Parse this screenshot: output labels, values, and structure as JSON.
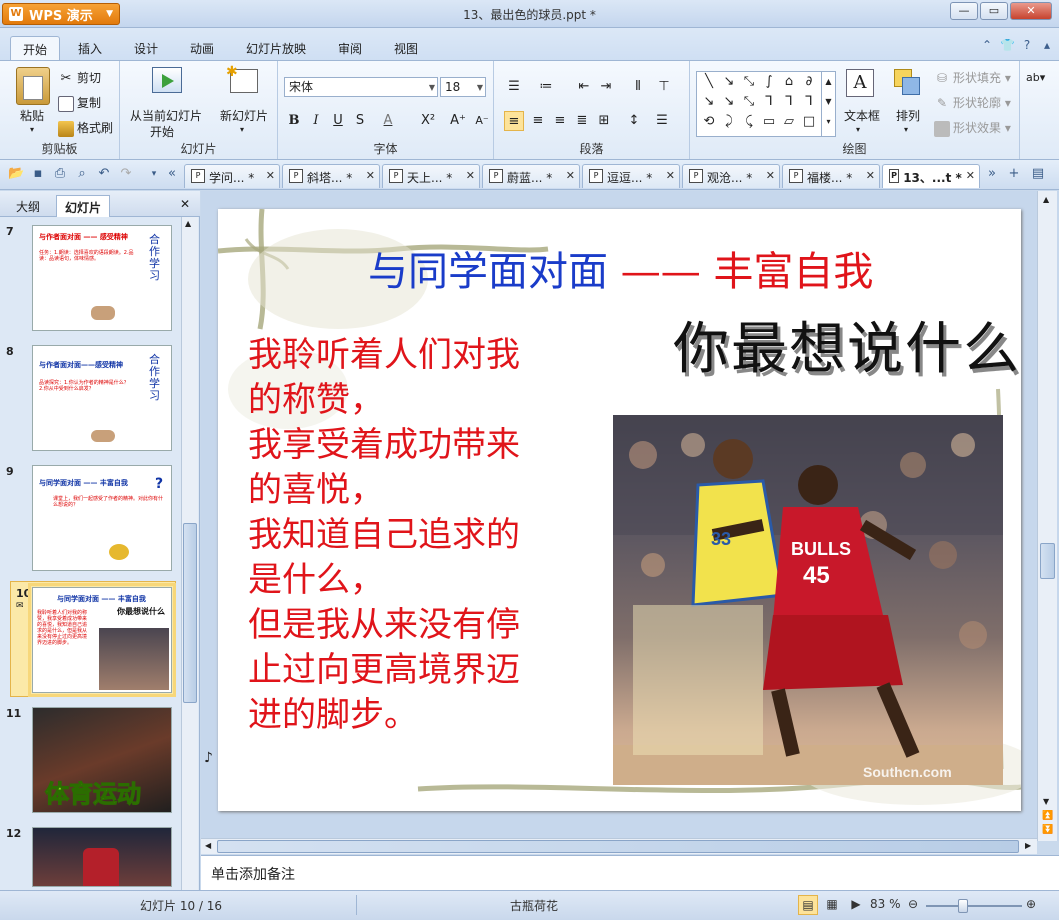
{
  "window": {
    "app_button": "WPS 演示",
    "title": "13、最出色的球员.ppt *"
  },
  "menu_tabs": [
    "开始",
    "插入",
    "设计",
    "动画",
    "幻灯片放映",
    "审阅",
    "视图"
  ],
  "ribbon": {
    "clipboard": {
      "paste": "粘贴",
      "cut": "剪切",
      "copy": "复制",
      "format_painter": "格式刷",
      "label": "剪贴板"
    },
    "slides": {
      "from_current": "从当前幻灯片",
      "from_current2": "开始",
      "new_slide": "新幻灯片",
      "label": "幻灯片"
    },
    "font": {
      "family": "宋体",
      "size": "18",
      "label": "字体"
    },
    "paragraph": {
      "label": "段落"
    },
    "drawing": {
      "textbox": "文本框",
      "arrange": "排列",
      "fill": "形状填充",
      "outline": "形状轮廓",
      "effect": "形状效果",
      "label": "绘图"
    }
  },
  "doc_tabs": [
    "学问... *",
    "斜塔... *",
    "天上... *",
    "蔚蓝... *",
    "逗逗... *",
    "观沧... *",
    "福楼... *",
    "13、...t *"
  ],
  "left_pane": {
    "tab_outline": "大纲",
    "tab_slides": "幻灯片",
    "thumbs": [
      {
        "num": "7",
        "title": "与作者面对面 —— 感受精神",
        "side": "合作学习",
        "text": "任务：1.朗读：选择喜欢的语段朗读。2.品读：品读语句，体味情感。"
      },
      {
        "num": "8",
        "title": "与作者面对面——感受精神",
        "side": "合作学习",
        "text": "品读探究：1.你认为作者的精神是什么？ 2.你从中受到什么启发？"
      },
      {
        "num": "9",
        "title": "与同学面对面 —— 丰富自我",
        "side": "?",
        "text": "课堂上，我们一起感受了作者的精神。对此你有什么想说的？"
      },
      {
        "num": "10",
        "title": "与同学面对面 —— 丰富自我",
        "side": "你最想说什么",
        "text": "我聆听着人们对我的称赞，我享受着成功带来的喜悦，我知道自己追求的是什么，但是我从来没有停止过向更高境界迈进的脚步。"
      },
      {
        "num": "11",
        "title": "体育运动",
        "side": "",
        "text": ""
      },
      {
        "num": "12",
        "title": "",
        "side": "",
        "text": ""
      }
    ]
  },
  "slide": {
    "title_blue": "与同学面对面",
    "title_dash": "——",
    "title_red": "丰富自我",
    "subtitle": "你最想说什么",
    "body": [
      "我聆听着人们对我",
      "的称赞，",
      "我享受着成功带来",
      "的喜悦，",
      "我知道自己追求的",
      "是什么，",
      "但是我从来没有停",
      "止过向更高境界迈",
      "进的脚步。"
    ],
    "jersey1": "BULLS",
    "jersey2": "45",
    "jersey3": "33",
    "watermark": "Southcn.com"
  },
  "notes_placeholder": "单击添加备注",
  "status": {
    "slide_pos": "幻灯片 10 / 16",
    "theme": "古瓶荷花",
    "zoom": "83 %"
  }
}
